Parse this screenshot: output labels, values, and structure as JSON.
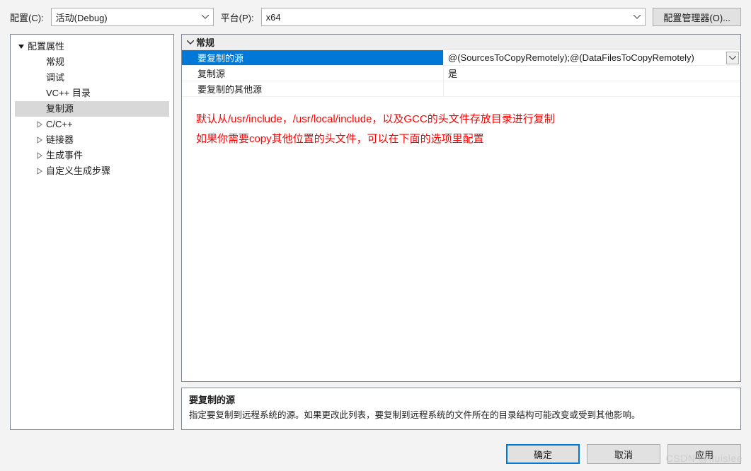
{
  "topbar": {
    "config_label": "配置(C):",
    "config_value": "活动(Debug)",
    "platform_label": "平台(P):",
    "platform_value": "x64",
    "manager_button": "配置管理器(O)..."
  },
  "tree": {
    "root": {
      "label": "配置属性",
      "expanded": true
    },
    "items": [
      {
        "label": "常规",
        "expandable": false
      },
      {
        "label": "调试",
        "expandable": false
      },
      {
        "label": "VC++ 目录",
        "expandable": false
      },
      {
        "label": "复制源",
        "expandable": false,
        "selected": true
      },
      {
        "label": "C/C++",
        "expandable": true
      },
      {
        "label": "链接器",
        "expandable": true
      },
      {
        "label": "生成事件",
        "expandable": true
      },
      {
        "label": "自定义生成步骤",
        "expandable": true
      }
    ]
  },
  "grid": {
    "category": "常规",
    "rows": [
      {
        "name": "要复制的源",
        "value": "@(SourcesToCopyRemotely);@(DataFilesToCopyRemotely)",
        "selected": true,
        "has_dropdown": true
      },
      {
        "name": "复制源",
        "value": "是"
      },
      {
        "name": "要复制的其他源",
        "value": ""
      }
    ]
  },
  "annotation": {
    "line1": "默认从/usr/include，/usr/local/include，以及GCC的头文件存放目录进行复制",
    "line2": "如果你需要copy其他位置的头文件，可以在下面的选项里配置"
  },
  "description": {
    "title": "要复制的源",
    "text": "指定要复制到远程系统的源。如果更改此列表，要复制到远程系统的文件所在的目录结构可能改变或受到其他影响。"
  },
  "footer": {
    "ok": "确定",
    "cancel": "取消",
    "apply": "应用"
  },
  "watermark": "CSDN @fluislee"
}
